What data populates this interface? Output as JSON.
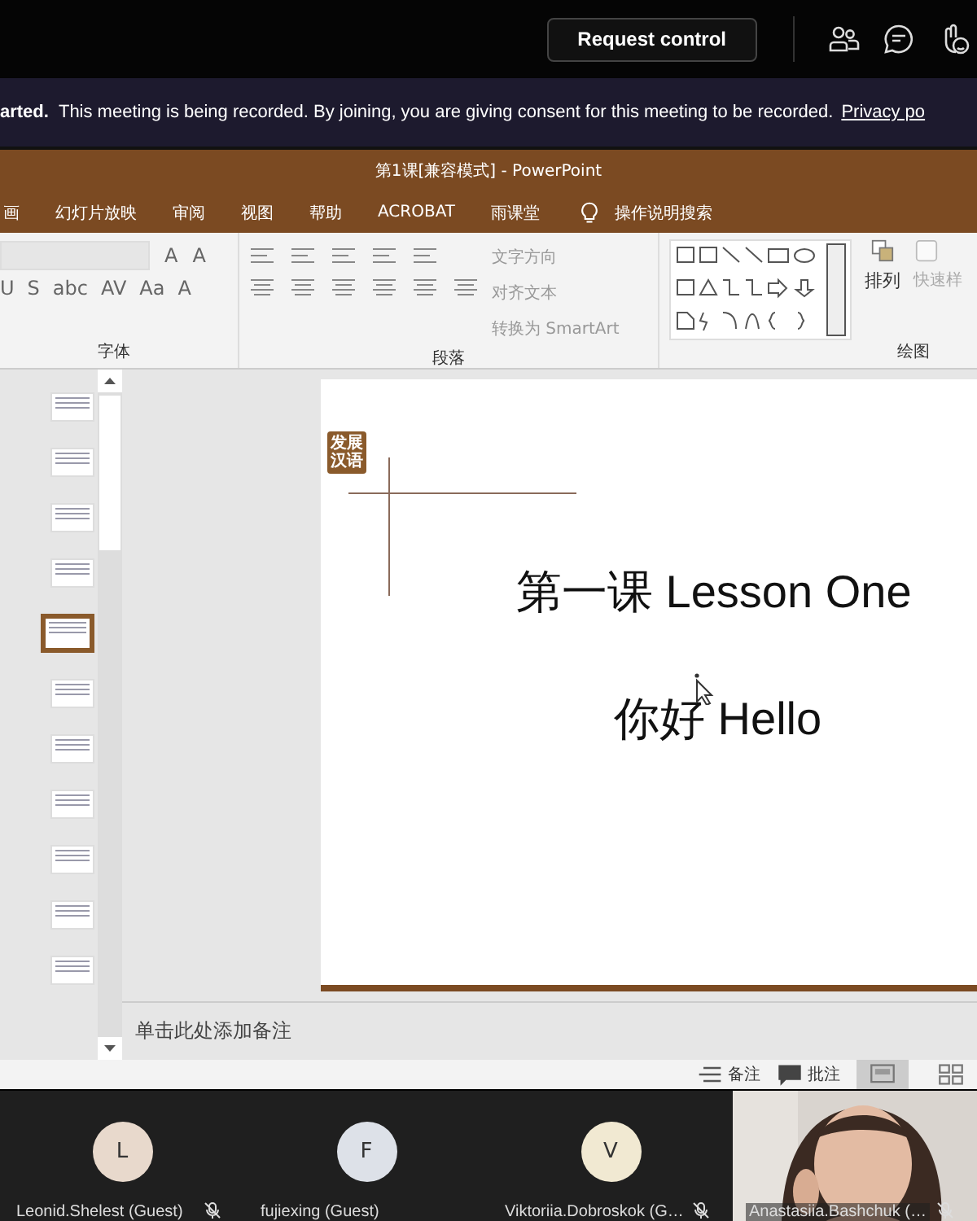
{
  "topbar": {
    "request_button": "Request control"
  },
  "banner": {
    "lead": "arted.",
    "message": "This meeting is being recorded. By joining, you are giving consent for this meeting to be recorded.",
    "link": "Privacy po"
  },
  "app": {
    "title": "第1课[兼容模式]  -  PowerPoint"
  },
  "menu": [
    {
      "label": "画",
      "kind": "tab"
    },
    {
      "label": "幻灯片放映",
      "kind": "tab"
    },
    {
      "label": "审阅",
      "kind": "tab"
    },
    {
      "label": "视图",
      "kind": "tab"
    },
    {
      "label": "帮助",
      "kind": "tab"
    },
    {
      "label": "ACROBAT",
      "kind": "tab"
    },
    {
      "label": "雨课堂",
      "kind": "tab"
    },
    {
      "label": "操作说明搜索",
      "kind": "search"
    }
  ],
  "ribbon": {
    "font": {
      "row1": [
        "A",
        "A"
      ],
      "row2": [
        "U",
        "S",
        "abc",
        "AV",
        "Aa",
        "A"
      ],
      "label": "字体"
    },
    "paragraph": {
      "commands": [
        "文字方向",
        "对齐文本",
        "转换为 SmartArt"
      ],
      "label": "段落"
    },
    "drawing": {
      "arrange": "排列",
      "quick_styles": "快速样",
      "label": "绘图"
    }
  },
  "thumbnails": [
    {
      "selected": false
    },
    {
      "selected": false
    },
    {
      "selected": false
    },
    {
      "selected": false
    },
    {
      "selected": true
    },
    {
      "selected": false
    },
    {
      "selected": false
    },
    {
      "selected": false
    },
    {
      "selected": false
    },
    {
      "selected": false
    },
    {
      "selected": false
    }
  ],
  "slide": {
    "logo": [
      "发展",
      "汉语"
    ],
    "title": "第一课 Lesson One",
    "subtitle": "你好  Hello"
  },
  "notes": {
    "placeholder": "单击此处添加备注"
  },
  "status_bar": {
    "notes": "备注",
    "comments": "批注",
    "views": [
      {
        "selected": true
      },
      {
        "selected": false
      }
    ]
  },
  "participants": [
    {
      "kind": "avatar",
      "initial": "L",
      "name": "Leonid.Shelest (Guest)",
      "color": "#e8d9cc",
      "muted": true
    },
    {
      "kind": "avatar",
      "initial": "F",
      "name": "fujiexing (Guest)",
      "color": "#dde1e8",
      "muted": false
    },
    {
      "kind": "avatar",
      "initial": "V",
      "name": "Viktoriia.Dobroskok (G…",
      "color": "#f1e9d2",
      "muted": true
    },
    {
      "kind": "video",
      "name": "Anastasiia.Bashchuk (…",
      "muted": true
    }
  ]
}
